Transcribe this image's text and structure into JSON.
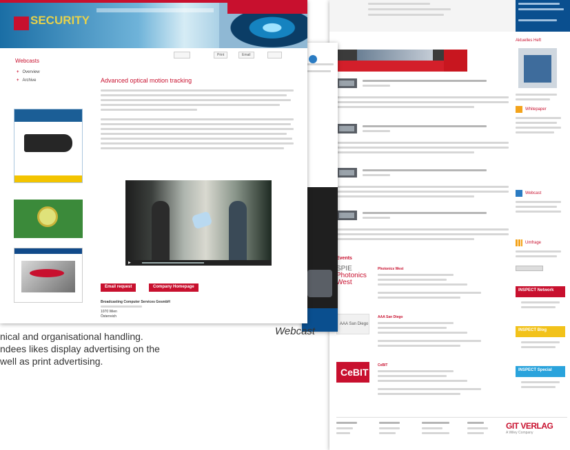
{
  "front": {
    "brand": "SECURITY",
    "sidebar": {
      "heading": "Webcasts",
      "links": [
        "Overview",
        "Archive"
      ]
    },
    "toolbar": {
      "print": "Print",
      "email": "Email"
    },
    "article": {
      "title": "Advanced optical motion tracking"
    },
    "buttons": {
      "email_request": "Email request",
      "company_homepage": "Company Homepage"
    },
    "company": {
      "name": "Broadcasting Computer Services GesmbH",
      "city": "1070 Wien",
      "country": "Österreich"
    }
  },
  "back": {
    "events_heading": "Events",
    "events": [
      {
        "logo": "SPIE Photonics West",
        "name": "Photonics West"
      },
      {
        "logo": "AAA San Diego",
        "name": "AAA San Diego"
      },
      {
        "logo": "CeBIT",
        "name": "CeBIT"
      }
    ],
    "right_col": {
      "aktuelles": "Aktuelles Heft",
      "whitepaper": "Whitepaper",
      "webcast": "Webcast",
      "umfrage": "Umfrage",
      "inspect_network": "INSPECT Network",
      "inspect_blog": "INSPECT Blog",
      "inspect_special": "INSPECT Special"
    },
    "footer_brand": "GIT VERLAG",
    "footer_brand_sub": "A Wiley Company"
  },
  "caption": {
    "line1": "nical and organisational handling.",
    "line2": "ndees likes display advertising on the",
    "line3": "well as print advertising."
  },
  "webcast_label": "Webcast",
  "colors": {
    "accent_red": "#c8102e",
    "header_blue": "#1a6ea5",
    "brand_yellow": "#e8d24a"
  }
}
